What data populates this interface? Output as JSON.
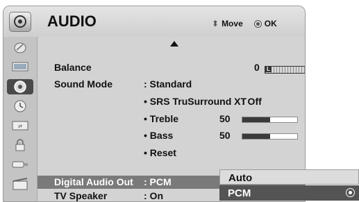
{
  "header": {
    "title": "AUDIO",
    "help_move": "Move",
    "help_ok": "OK"
  },
  "sidebar": {
    "items": [
      {
        "icon": "satellite-dish-icon"
      },
      {
        "icon": "picture-icon"
      },
      {
        "icon": "audio-speaker-icon",
        "active": true
      },
      {
        "icon": "clock-icon"
      },
      {
        "icon": "input-icon"
      },
      {
        "icon": "lock-icon"
      },
      {
        "icon": "usb-icon"
      },
      {
        "icon": "movie-icon"
      }
    ]
  },
  "menu": {
    "balance": {
      "label": "Balance",
      "value": "0",
      "left": "L",
      "right": "R",
      "level": 0
    },
    "sound_mode": {
      "label": "Sound Mode",
      "value": ": Standard"
    },
    "srs": {
      "label": "• SRS TruSurround XT",
      "value": ": Off"
    },
    "treble": {
      "label": "• Treble",
      "value": "50",
      "level_percent": 50
    },
    "bass": {
      "label": "• Bass",
      "value": "50",
      "level_percent": 50
    },
    "reset": {
      "label": "• Reset"
    },
    "digital_audio_out": {
      "label": "Digital Audio Out",
      "value": ": PCM"
    },
    "tv_speaker": {
      "label": "TV Speaker",
      "value": ": On"
    }
  },
  "popup": {
    "options": [
      "Auto",
      "PCM"
    ],
    "selected": "PCM"
  },
  "colors": {
    "menu_bg": "#d3d3d3",
    "highlight": "#7a7a7a",
    "popup_selected": "#545454"
  }
}
